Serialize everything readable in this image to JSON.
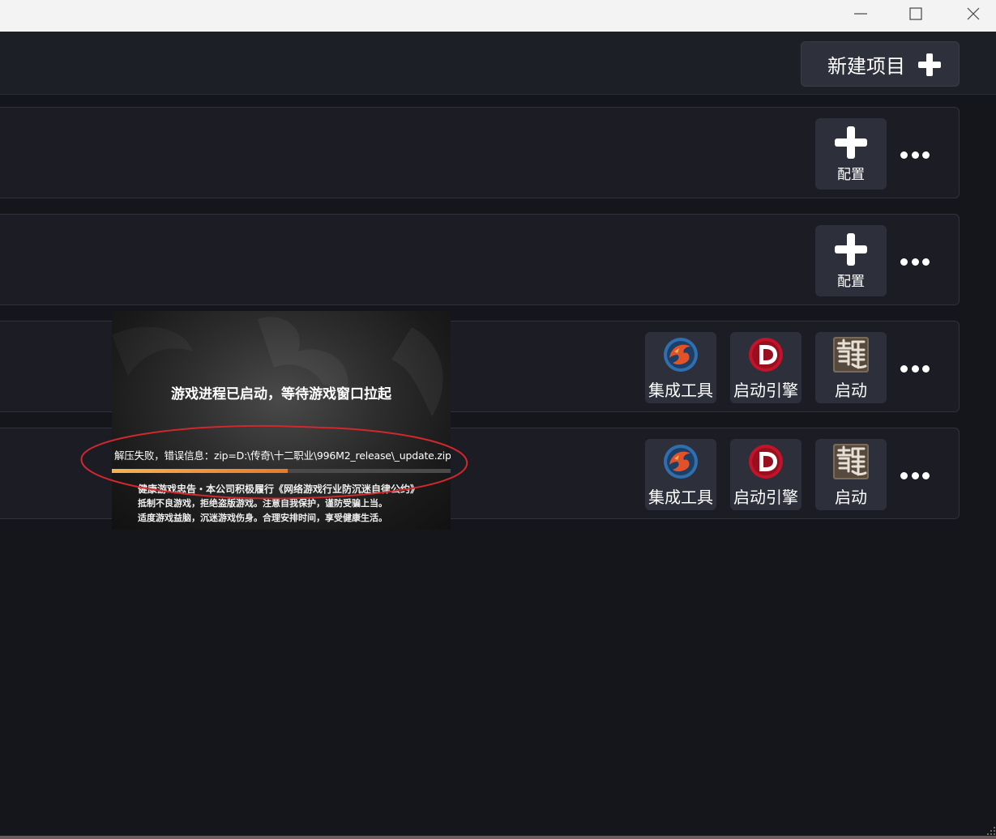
{
  "window": {
    "controls": [
      "minimize-icon",
      "maximize-icon",
      "close-icon"
    ]
  },
  "header": {
    "new_project_label": "新建项目",
    "new_project_icon": "plus-icon"
  },
  "rows": [
    {
      "tiles": [
        {
          "label": "配置",
          "icon": "plus-icon"
        }
      ],
      "more_icon": "more-dots-icon"
    },
    {
      "tiles": [
        {
          "label": "配置",
          "icon": "plus-icon"
        }
      ],
      "more_icon": "more-dots-icon"
    },
    {
      "tiles": [
        {
          "label": "集成工具",
          "icon": "dragon-logo-icon"
        },
        {
          "label": "启动引擎",
          "icon": "d-logo-icon"
        },
        {
          "label": "启动",
          "icon": "long-char-icon"
        }
      ],
      "more_icon": "more-dots-icon"
    },
    {
      "tiles": [
        {
          "label": "集成工具",
          "icon": "dragon-logo-icon"
        },
        {
          "label": "启动引擎",
          "icon": "d-logo-icon"
        },
        {
          "label": "启动",
          "icon": "long-char-icon"
        }
      ],
      "more_icon": "more-dots-icon"
    }
  ],
  "popup": {
    "launch_message": "游戏进程已启动，等待游戏窗口拉起",
    "error_message": "解压失败，错误信息：zip=D:\\传奇\\十二职业\\996M2_release\\_update.zip",
    "progress_fraction": 0.52,
    "notice_lines": [
      "健康游戏忠告・本公司积极履行《网络游戏行业防沉迷自律公约》",
      "抵制不良游戏，拒绝盗版游戏。注意自我保护，谨防受骗上当。",
      "适度游戏益脑，沉迷游戏伤身。合理安排时间，享受健康生活。"
    ]
  },
  "colors": {
    "background": "#15161c",
    "row": "#1b1c24",
    "tile": "#2d2f3a",
    "progress": "#f0953a",
    "annotation": "#d0282d"
  }
}
